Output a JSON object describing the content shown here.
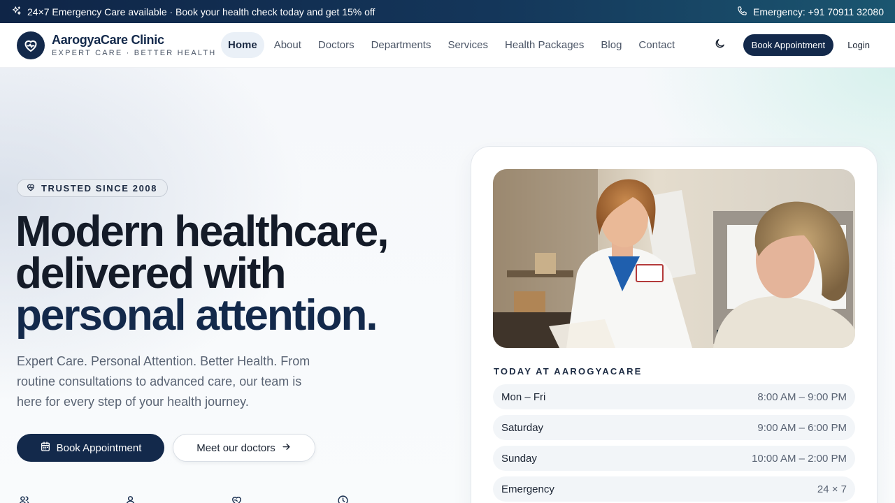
{
  "topbar": {
    "promo": "24×7 Emergency Care available · Book your health check today and get 15% off",
    "emergency": "Emergency: +91 70911 32080"
  },
  "brand": {
    "name": "AarogyaCare Clinic",
    "tagline": "EXPERT CARE · BETTER HEALTH"
  },
  "nav": {
    "items": [
      {
        "label": "Home",
        "active": true
      },
      {
        "label": "About"
      },
      {
        "label": "Doctors"
      },
      {
        "label": "Departments"
      },
      {
        "label": "Services"
      },
      {
        "label": "Health Packages"
      },
      {
        "label": "Blog"
      },
      {
        "label": "Contact"
      }
    ],
    "book_label": "Book Appointment",
    "login_label": "Login"
  },
  "hero": {
    "badge": "TRUSTED SINCE 2008",
    "headline_line1": "Modern healthcare,",
    "headline_line2": "delivered with",
    "headline_accent": "personal attention.",
    "lead": "Expert Care. Personal Attention. Better Health. From routine consultations to advanced care, our team is here for every step of your health journey.",
    "cta_primary": "Book Appointment",
    "cta_secondary": "Meet our doctors"
  },
  "card": {
    "label": "TODAY AT AAROGYACARE",
    "hours": [
      {
        "day": "Mon – Fri",
        "time": "8:00 AM – 9:00 PM"
      },
      {
        "day": "Saturday",
        "time": "9:00 AM – 6:00 PM"
      },
      {
        "day": "Sunday",
        "time": "10:00 AM – 2:00 PM"
      },
      {
        "day": "Emergency",
        "time": "24 × 7"
      }
    ]
  },
  "colors": {
    "primary": "#13294b",
    "accent_gradient_end": "#1b5670"
  },
  "icons": [
    "sparkles-icon",
    "phone-icon",
    "heart-pulse-icon",
    "moon-icon",
    "calendar-icon",
    "arrow-right-icon",
    "users-icon",
    "user-icon",
    "heart-handshake-icon",
    "clock-icon"
  ]
}
